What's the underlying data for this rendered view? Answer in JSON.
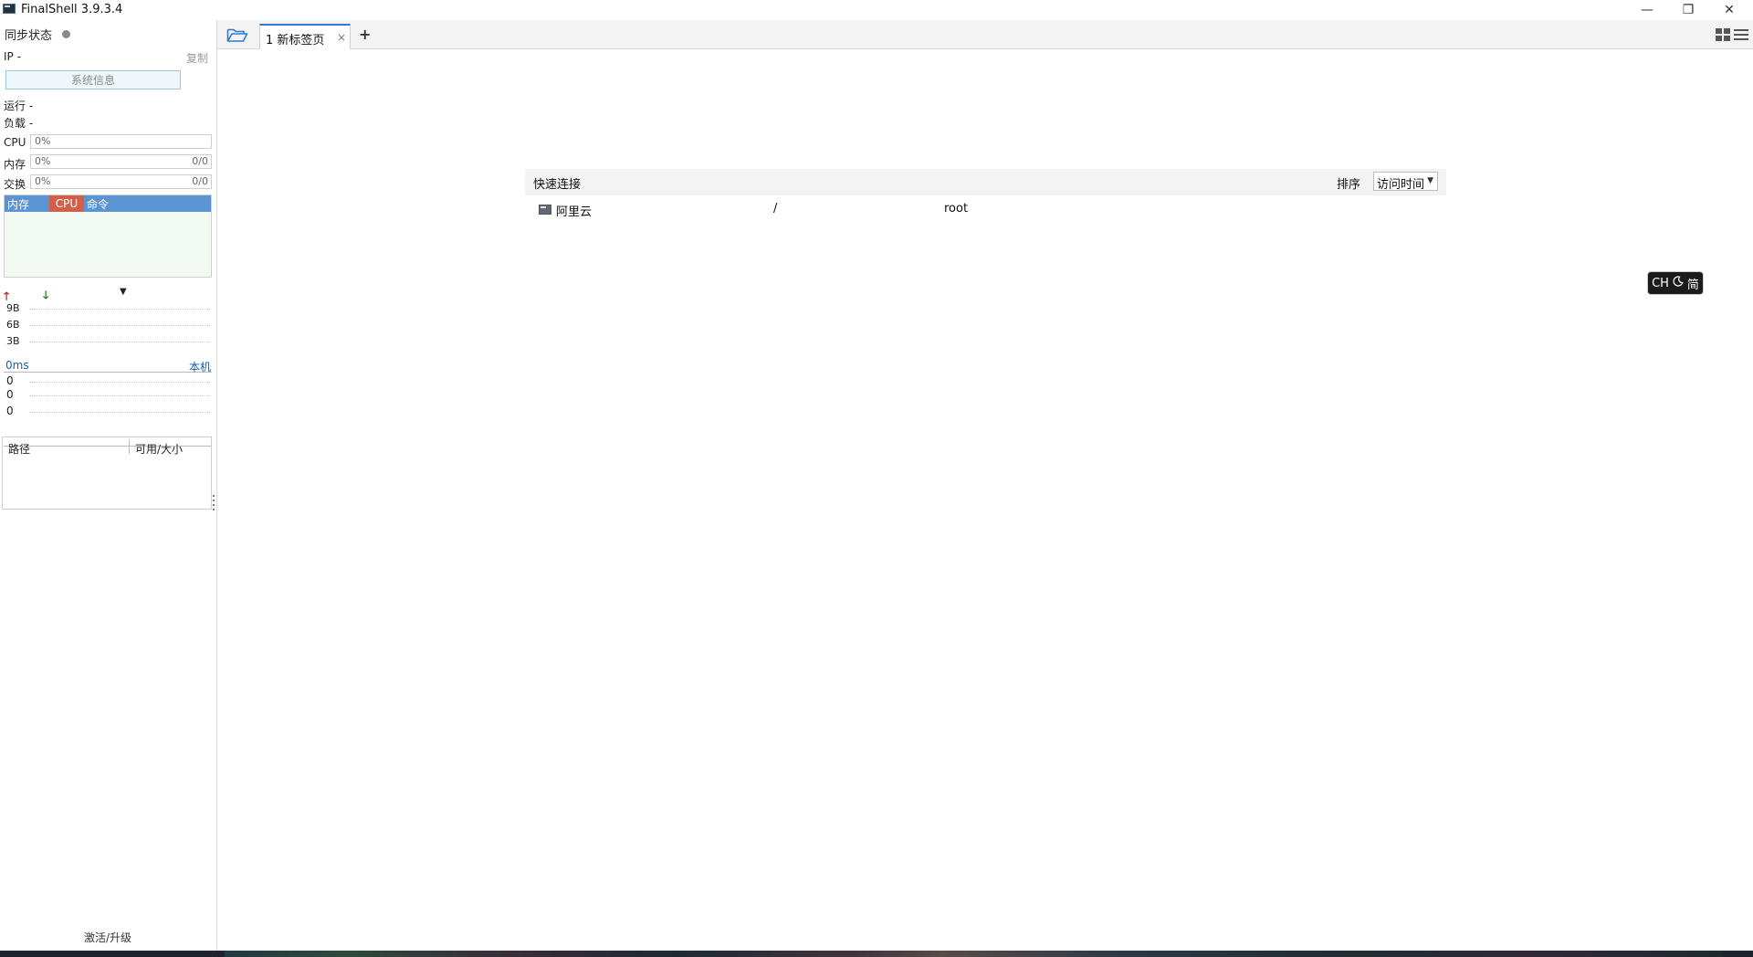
{
  "window": {
    "title": "FinalShell 3.9.3.4",
    "controls": {
      "minimize": "—",
      "restore": "❐",
      "close": "✕"
    }
  },
  "sidebar": {
    "sync_status_label": "同步状态",
    "ip_label": "IP  -",
    "copy_label": "复制",
    "sysinfo_button": "系统信息",
    "run_label": "运行 -",
    "load_label": "负载 -",
    "meters": {
      "cpu": {
        "label": "CPU",
        "percent": "0%",
        "extra": ""
      },
      "mem": {
        "label": "内存",
        "percent": "0%",
        "extra": "0/0"
      },
      "swap": {
        "label": "交换",
        "percent": "0%",
        "extra": "0/0"
      }
    },
    "process_table": {
      "col_mem": "内存",
      "col_cpu": "CPU",
      "col_cmd": "命令"
    },
    "net_graph": {
      "labels": [
        "9B",
        "6B",
        "3B"
      ]
    },
    "ping": {
      "latency": "0ms",
      "local_label": "本机",
      "labels": [
        "0",
        "0",
        "0"
      ]
    },
    "disk_table": {
      "col_path": "路径",
      "col_size": "可用/大小"
    },
    "activate_label": "激活/升级"
  },
  "tabs": [
    {
      "label": "1 新标签页",
      "close": "×"
    }
  ],
  "add_tab": "+",
  "quick_connect": {
    "title": "快速连接",
    "sort_label": "排序",
    "sort_value": "访问时间",
    "rows": [
      {
        "name": "阿里云",
        "path": "/",
        "user": "root"
      }
    ]
  },
  "ime": {
    "lang": "CH",
    "mode": "简"
  },
  "colors": {
    "accent_blue": "#2f7ad6",
    "process_header": "#5b94d0",
    "cpu_highlight": "#d0604a",
    "up_arrow": "#b0221c",
    "down_arrow": "#1a7a24",
    "link_blue": "#1a5fa0"
  },
  "icons": {
    "app": "terminal-icon",
    "folder": "folder-open-icon",
    "grid": "grid-view-icon",
    "list": "list-view-icon",
    "row": "server-icon",
    "moon": "moon-icon"
  }
}
